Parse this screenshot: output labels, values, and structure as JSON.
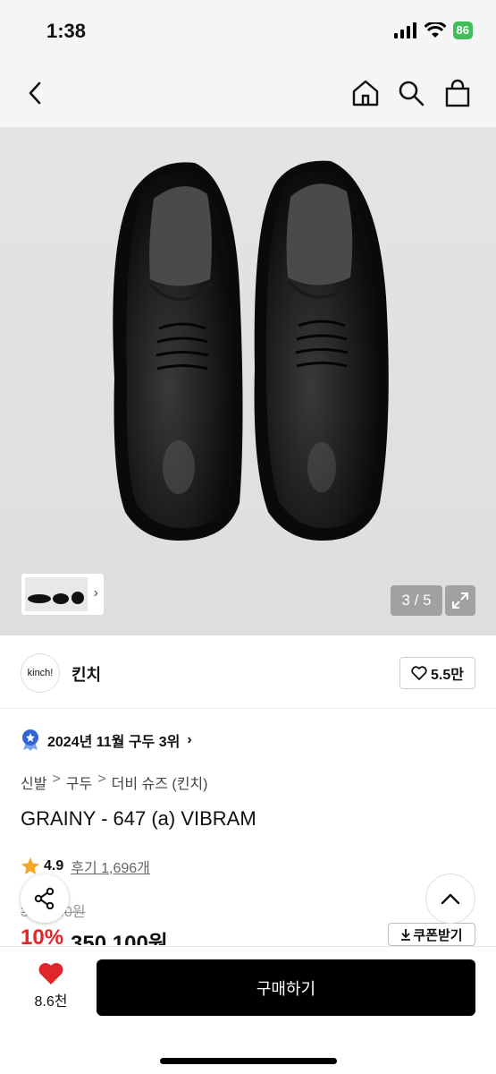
{
  "status": {
    "time": "1:38",
    "battery": "86"
  },
  "nav": {
    "back": "back-icon",
    "home": "home-icon",
    "search": "search-icon",
    "bag": "shopping-bag-icon"
  },
  "gallery": {
    "counter": "3 / 5"
  },
  "brand": {
    "logo_text": "kinch!",
    "name": "킨치",
    "likes": "5.5만"
  },
  "rank": {
    "text": "2024년 11월 구두 3위"
  },
  "breadcrumb": {
    "c1": "신발",
    "c2": "구두",
    "c3": "더비 슈즈 (킨치)",
    "sep": ">"
  },
  "product": {
    "title": "GRAINY - 647 (a) VIBRAM"
  },
  "rating": {
    "score": "4.9",
    "reviews": "후기 1,696개"
  },
  "price": {
    "original": "390,000원",
    "discount": "10%",
    "sale": "350,100원",
    "coupon": "쿠폰받기"
  },
  "bottom": {
    "wish_count": "8.6천",
    "buy_label": "구매하기"
  },
  "colors": {
    "accent_red": "#e0262b",
    "battery_green": "#3fbf5a"
  }
}
